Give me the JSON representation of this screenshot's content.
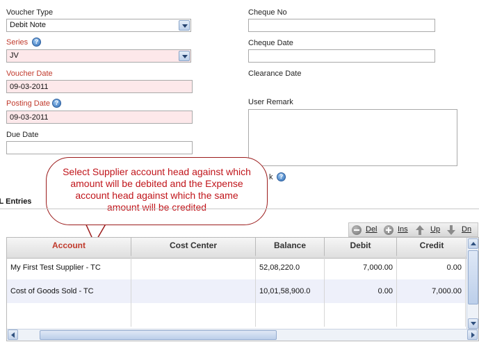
{
  "form": {
    "voucher_type": {
      "label": "Voucher Type",
      "value": "Debit Note"
    },
    "series": {
      "label": "Series",
      "value": "JV"
    },
    "voucher_date": {
      "label": "Voucher Date",
      "value": "09-03-2011"
    },
    "posting_date": {
      "label": "Posting Date",
      "value": "09-03-2011"
    },
    "due_date": {
      "label": "Due Date",
      "value": ""
    },
    "cheque_no": {
      "label": "Cheque No",
      "value": ""
    },
    "cheque_date": {
      "label": "Cheque Date",
      "value": ""
    },
    "clearance_date": {
      "label": "Clearance Date"
    },
    "user_remark": {
      "label": "User Remark",
      "value": ""
    },
    "partial_label": "k"
  },
  "callout": {
    "text": "Select Supplier account head against which amount will be debited and the Expense account head against which the same amount will be credited"
  },
  "gl_entries": {
    "title": "GL Entries",
    "title_visible": "GL Entries",
    "toolbar": {
      "del": "Del",
      "ins": "Ins",
      "up": "Up",
      "dn": "Dn"
    },
    "columns": [
      "Account",
      "Cost Center",
      "Balance",
      "Debit",
      "Credit"
    ],
    "rows": [
      {
        "account": "My First Test Supplier - TC",
        "cost_center": "",
        "balance": "52,08,220.0",
        "debit": "7,000.00",
        "credit": "0.00"
      },
      {
        "account": "Cost of Goods Sold - TC",
        "cost_center": "",
        "balance": "10,01,58,900.0",
        "debit": "0.00",
        "credit": "7,000.00"
      }
    ]
  },
  "colors": {
    "required_label": "#c0392b",
    "mandatory_field_bg": "#fde8ea",
    "callout_text": "#c0141a",
    "row_alt_bg": "#eef0fa"
  },
  "icons": [
    "help-icon",
    "delete-row-icon",
    "insert-row-icon",
    "move-up-icon",
    "move-down-icon",
    "chevron-down-icon"
  ]
}
